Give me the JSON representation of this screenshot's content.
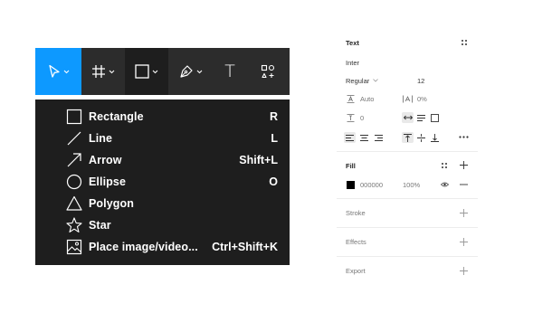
{
  "toolbar": {
    "tools": [
      {
        "id": "move",
        "icon": "move-icon"
      },
      {
        "id": "frame",
        "icon": "frame-icon"
      },
      {
        "id": "shape",
        "icon": "rectangle-icon"
      },
      {
        "id": "pen",
        "icon": "pen-icon"
      },
      {
        "id": "text",
        "icon": "text-icon",
        "glyph": "T"
      },
      {
        "id": "actions",
        "icon": "actions-icon"
      }
    ],
    "accent": "#0d99ff"
  },
  "shape_menu": {
    "items": [
      {
        "label": "Rectangle",
        "shortcut": "R",
        "icon": "rectangle-icon"
      },
      {
        "label": "Line",
        "shortcut": "L",
        "icon": "line-icon"
      },
      {
        "label": "Arrow",
        "shortcut": "Shift+L",
        "icon": "arrow-icon"
      },
      {
        "label": "Ellipse",
        "shortcut": "O",
        "icon": "ellipse-icon"
      },
      {
        "label": "Polygon",
        "shortcut": "",
        "icon": "polygon-icon"
      },
      {
        "label": "Star",
        "shortcut": "",
        "icon": "star-icon"
      },
      {
        "label": "Place image/video...",
        "shortcut": "Ctrl+Shift+K",
        "icon": "image-icon"
      }
    ]
  },
  "panel": {
    "text": {
      "title": "Text",
      "font": "Inter",
      "weight": "Regular",
      "size": "12",
      "line_height": "Auto",
      "letter_spacing": "0%",
      "paragraph_spacing": "0"
    },
    "fill": {
      "title": "Fill",
      "color_hex": "000000",
      "swatch": "#000000",
      "opacity": "100%"
    },
    "stroke": {
      "title": "Stroke"
    },
    "effects": {
      "title": "Effects"
    },
    "export": {
      "title": "Export"
    }
  }
}
